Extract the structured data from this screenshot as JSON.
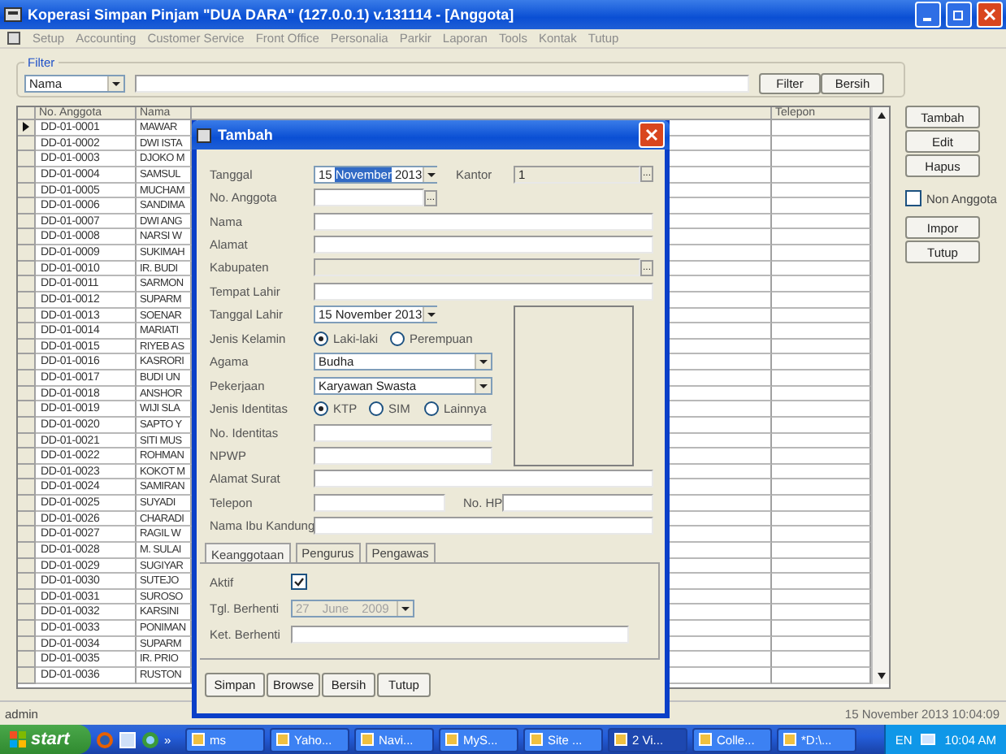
{
  "window": {
    "title": "Koperasi Simpan Pinjam \"DUA DARA\" (127.0.0.1) v.131114 - [Anggota]"
  },
  "menu": [
    "Setup",
    "Accounting",
    "Customer Service",
    "Front Office",
    "Personalia",
    "Parkir",
    "Laporan",
    "Tools",
    "Kontak",
    "Tutup"
  ],
  "filter": {
    "title": "Filter",
    "field": "Nama",
    "buttons": [
      "Filter",
      "Bersih"
    ]
  },
  "table": {
    "columns": [
      "No. Anggota",
      "Nama",
      "Telepon"
    ],
    "rows": [
      {
        "no": "DD-01-0001",
        "nama": "MAWAR",
        "current": true
      },
      {
        "no": "DD-01-0002",
        "nama": "DWI ISTA",
        "current": false
      },
      {
        "no": "DD-01-0003",
        "nama": "DJOKO M",
        "current": false
      },
      {
        "no": "DD-01-0004",
        "nama": "SAMSUL",
        "current": false
      },
      {
        "no": "DD-01-0005",
        "nama": "MUCHAM",
        "current": false
      },
      {
        "no": "DD-01-0006",
        "nama": "SANDIMA",
        "current": false
      },
      {
        "no": "DD-01-0007",
        "nama": "DWI ANG",
        "current": false
      },
      {
        "no": "DD-01-0008",
        "nama": "NARSI W",
        "current": false
      },
      {
        "no": "DD-01-0009",
        "nama": "SUKIMAH",
        "current": false
      },
      {
        "no": "DD-01-0010",
        "nama": "IR. BUDI",
        "current": false
      },
      {
        "no": "DD-01-0011",
        "nama": "SARMON",
        "current": false
      },
      {
        "no": "DD-01-0012",
        "nama": "SUPARM",
        "current": false
      },
      {
        "no": "DD-01-0013",
        "nama": "SOENAR",
        "current": false
      },
      {
        "no": "DD-01-0014",
        "nama": "MARIATI",
        "current": false
      },
      {
        "no": "DD-01-0015",
        "nama": "RIYEB AS",
        "current": false
      },
      {
        "no": "DD-01-0016",
        "nama": "KASRORI",
        "current": false
      },
      {
        "no": "DD-01-0017",
        "nama": "BUDI UN",
        "current": false
      },
      {
        "no": "DD-01-0018",
        "nama": "ANSHOR",
        "current": false
      },
      {
        "no": "DD-01-0019",
        "nama": "WIJI SLA",
        "current": false
      },
      {
        "no": "DD-01-0020",
        "nama": "SAPTO Y",
        "current": false
      },
      {
        "no": "DD-01-0021",
        "nama": "SITI MUS",
        "current": false
      },
      {
        "no": "DD-01-0022",
        "nama": "ROHMAN",
        "current": false
      },
      {
        "no": "DD-01-0023",
        "nama": "KOKOT M",
        "current": false
      },
      {
        "no": "DD-01-0024",
        "nama": "SAMIRAN",
        "current": false
      },
      {
        "no": "DD-01-0025",
        "nama": "SUYADI",
        "current": false
      },
      {
        "no": "DD-01-0026",
        "nama": "CHARADI",
        "current": false
      },
      {
        "no": "DD-01-0027",
        "nama": "RAGIL W",
        "current": false
      },
      {
        "no": "DD-01-0028",
        "nama": "M. SULAI",
        "current": false
      },
      {
        "no": "DD-01-0029",
        "nama": "SUGIYAR",
        "current": false
      },
      {
        "no": "DD-01-0030",
        "nama": "SUTEJO",
        "current": false
      },
      {
        "no": "DD-01-0031",
        "nama": "SUROSO",
        "current": false
      },
      {
        "no": "DD-01-0032",
        "nama": "KARSINI",
        "current": false
      },
      {
        "no": "DD-01-0033",
        "nama": "PONIMAN",
        "current": false
      },
      {
        "no": "DD-01-0034",
        "nama": "SUPARM",
        "current": false
      },
      {
        "no": "DD-01-0035",
        "nama": "IR. PRIO",
        "current": false
      },
      {
        "no": "DD-01-0036",
        "nama": "RUSTON",
        "current": false
      }
    ]
  },
  "side_buttons": [
    "Tambah",
    "Edit",
    "Hapus"
  ],
  "non_anggota": {
    "label": "Non Anggota",
    "checked": false
  },
  "side_buttons_2": [
    "Impor",
    "Tutup"
  ],
  "status_bar": {
    "user": "admin",
    "datetime": "15 November 2013 10:04:09"
  },
  "dialog": {
    "title": "Tambah",
    "fields": [
      {
        "kind": "date",
        "label": "Tanggal",
        "parts": [
          {
            "text": "15",
            "selected": false
          },
          {
            "text": "November",
            "selected": true
          },
          {
            "text": "2013",
            "selected": false
          }
        ],
        "side": {
          "label": "Kantor",
          "value": "1",
          "button": "..."
        }
      },
      {
        "kind": "short-lookup",
        "label": "No. Anggota",
        "button": "..."
      },
      {
        "kind": "text",
        "label": "Nama"
      },
      {
        "kind": "text",
        "label": "Alamat"
      },
      {
        "kind": "lookup",
        "label": "Kabupaten",
        "disabled": true,
        "button": "..."
      },
      {
        "kind": "text",
        "label": "Tempat Lahir"
      },
      {
        "kind": "date",
        "label": "Tanggal Lahir",
        "parts": [
          {
            "text": "15",
            "selected": false
          },
          {
            "text": "November",
            "selected": false
          },
          {
            "text": "2013",
            "selected": false
          }
        ]
      },
      {
        "kind": "radio",
        "label": "Jenis Kelamin",
        "options": [
          {
            "label": "Laki-laki",
            "selected": true
          },
          {
            "label": "Perempuan",
            "selected": false
          }
        ]
      },
      {
        "kind": "select",
        "label": "Agama",
        "value": "Budha"
      },
      {
        "kind": "select",
        "label": "Pekerjaan",
        "value": "Karyawan Swasta"
      },
      {
        "kind": "radio",
        "label": "Jenis Identitas",
        "options": [
          {
            "label": "KTP",
            "selected": true
          },
          {
            "label": "SIM",
            "selected": false
          },
          {
            "label": "Lainnya",
            "selected": false
          }
        ]
      },
      {
        "kind": "text",
        "label": "No. Identitas"
      },
      {
        "kind": "text",
        "label": "NPWP"
      },
      {
        "kind": "text",
        "label": "Alamat Surat"
      },
      {
        "kind": "text",
        "label": "Telepon",
        "side": {
          "label": "No. HP"
        }
      },
      {
        "kind": "text",
        "label": "Nama Ibu Kandung"
      }
    ],
    "tabs": [
      {
        "label": "Keanggotaan",
        "selected": true
      },
      {
        "label": "Pengurus",
        "selected": false
      },
      {
        "label": "Pengawas",
        "selected": false
      }
    ],
    "active": {
      "label": "Aktif",
      "checked": true
    },
    "stop_date": {
      "label": "Tgl. Berhenti",
      "disabled": true,
      "parts": [
        {
          "text": "27",
          "selected": false
        },
        {
          "text": "June",
          "selected": false
        },
        {
          "text": "2009",
          "selected": false
        }
      ]
    },
    "stop_note": {
      "label": "Ket. Berhenti"
    },
    "buttons": [
      "Simpan",
      "Browse",
      "Bersih",
      "Tutup"
    ]
  },
  "taskbar": {
    "start": "start",
    "more": "»",
    "tasks": [
      {
        "label": "ms",
        "selected": false
      },
      {
        "label": "Yaho...",
        "selected": false
      },
      {
        "label": "Navi...",
        "selected": false
      },
      {
        "label": "MyS...",
        "selected": false
      },
      {
        "label": "Site ...",
        "selected": false
      },
      {
        "label": "2 Vi...",
        "selected": true
      },
      {
        "label": "Colle...",
        "selected": false
      },
      {
        "label": "*D:\\...",
        "selected": false
      }
    ],
    "language": "EN",
    "time": "10:04 AM"
  }
}
